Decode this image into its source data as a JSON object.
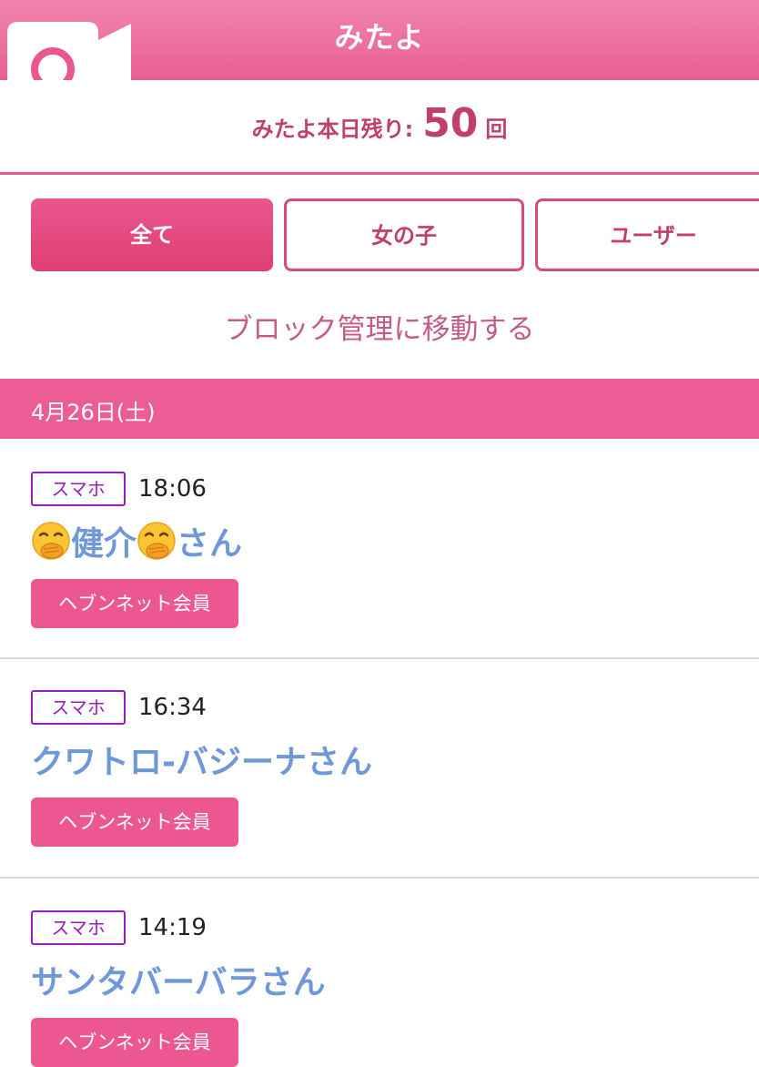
{
  "header": {
    "title": "みたよ"
  },
  "counter": {
    "label": "みたよ本日残り:",
    "value": "50",
    "unit": "回"
  },
  "filters": {
    "all": "全て",
    "girls": "女の子",
    "users": "ユーザー"
  },
  "block_link": "ブロック管理に移動する",
  "date_header": "4月26日(土)",
  "visits": [
    {
      "device": "スマホ",
      "time": "18:06",
      "name_core": "健介",
      "name_suffix": "さん",
      "member": "ヘブンネット会員"
    },
    {
      "device": "スマホ",
      "time": "16:34",
      "name": "クワトロ-バジーナさん",
      "member": "ヘブンネット会員"
    },
    {
      "device": "スマホ",
      "time": "14:19",
      "name": "サンタバーバラさん",
      "member": "ヘブンネット会員"
    }
  ],
  "icons": {
    "header_icon": "camera-icon",
    "name_emoji": "hand-over-mouth-emoji-icon"
  },
  "colors": {
    "header_pink": "#e95e92",
    "accent_dark_pink": "#c13f6d",
    "member_pink": "#ec5792",
    "visitor_blue": "#6f98d8",
    "device_purple": "#9a1ebf"
  }
}
